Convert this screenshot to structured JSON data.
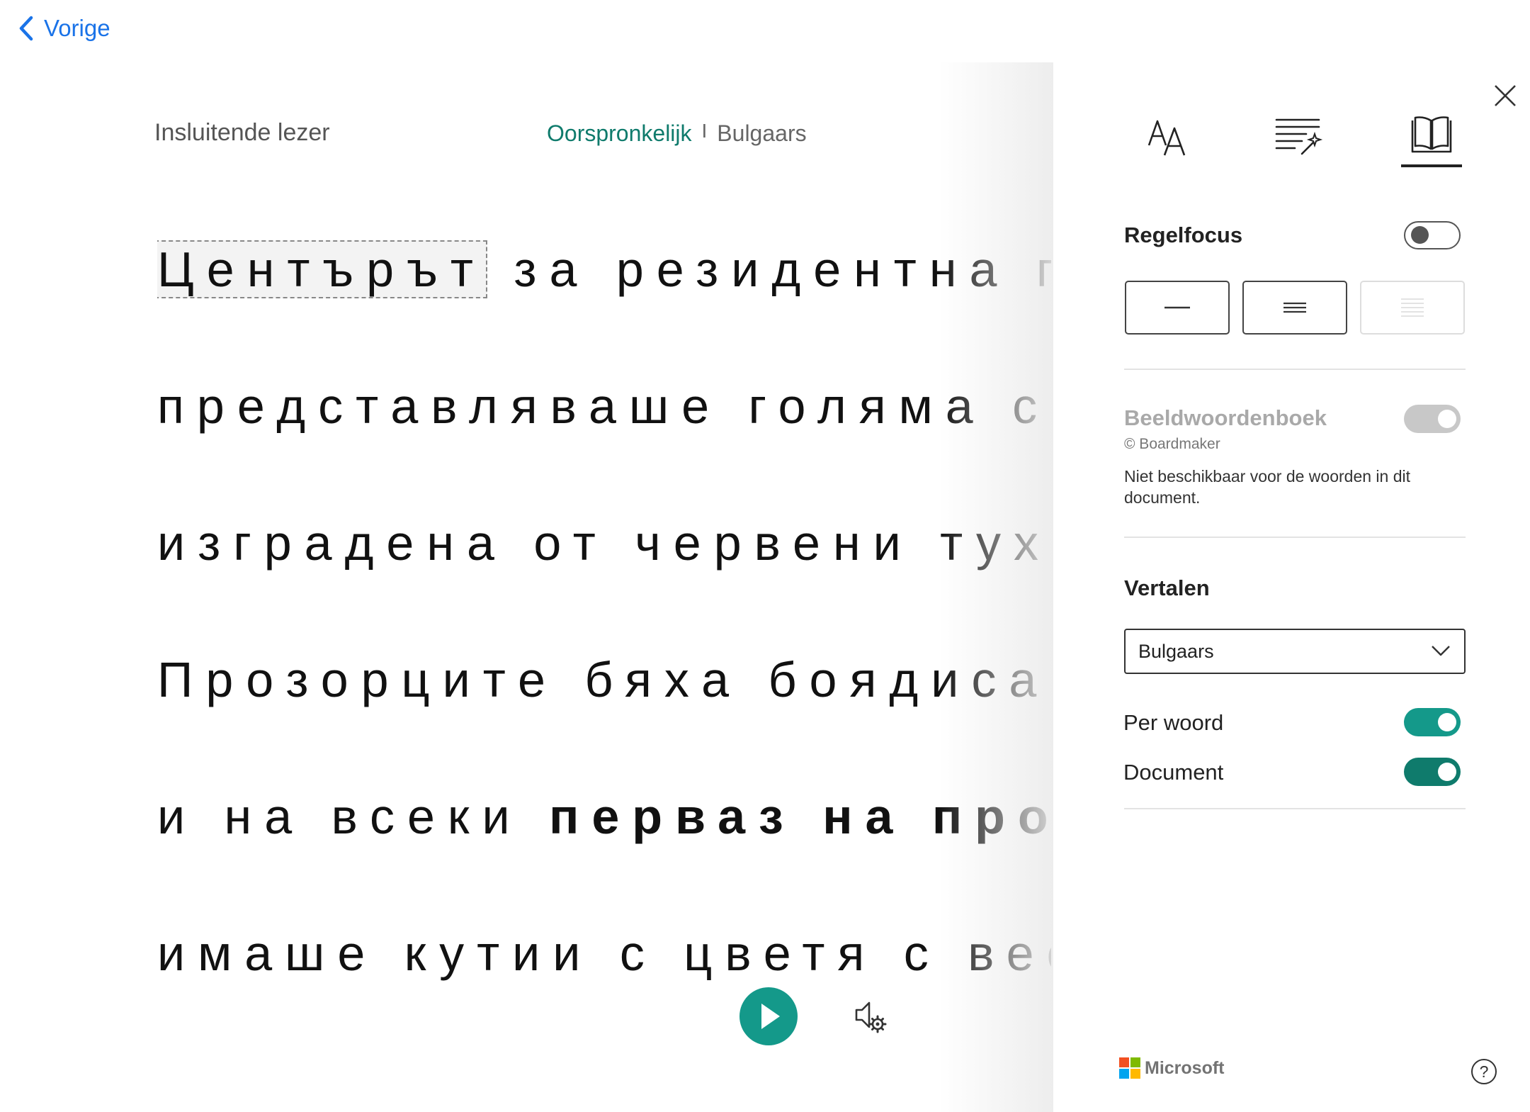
{
  "nav": {
    "back_label": "Vorige"
  },
  "reader": {
    "title": "Insluitende lezer",
    "original_label": "Oorspronkelijk",
    "separator": "I",
    "translated_label": "Bulgaars",
    "lines": [
      {
        "focus_word": "Центърът",
        "rest": " за резидентна гр"
      },
      {
        "text": "представляваше голяма сг"
      },
      {
        "text": "изградена от червени тухл"
      },
      {
        "text": "Прозорците бяха боядисан"
      },
      {
        "normal": "и на всеки ",
        "bold": "перваз на проз"
      },
      {
        "text": "имаше кутии с цветя с вес"
      }
    ]
  },
  "controls": {
    "play_icon": "play-icon",
    "voice_settings_icon": "voice-settings-icon"
  },
  "panel": {
    "tabs": [
      {
        "icon": "text-size-icon"
      },
      {
        "icon": "grammar-options-icon"
      },
      {
        "icon": "reading-preferences-icon",
        "active": true
      }
    ],
    "line_focus": {
      "label": "Regelfocus",
      "on": false
    },
    "picture_dictionary": {
      "label": "Beeldwoordenboek",
      "sub": "© Boardmaker",
      "note": "Niet beschikbaar voor de woorden in dit document.",
      "enabled": false
    },
    "translate": {
      "label": "Vertalen",
      "selected": "Bulgaars",
      "per_word": {
        "label": "Per woord",
        "on": true
      },
      "document": {
        "label": "Document",
        "on": true
      }
    },
    "footer": {
      "brand": "Microsoft",
      "help": "?"
    }
  },
  "colors": {
    "accent": "#14998a",
    "accent_dark": "#0f7b6c",
    "link": "#1a73e8",
    "ms_red": "#f25022",
    "ms_green": "#7fba00",
    "ms_blue": "#00a4ef",
    "ms_yellow": "#ffb900"
  }
}
